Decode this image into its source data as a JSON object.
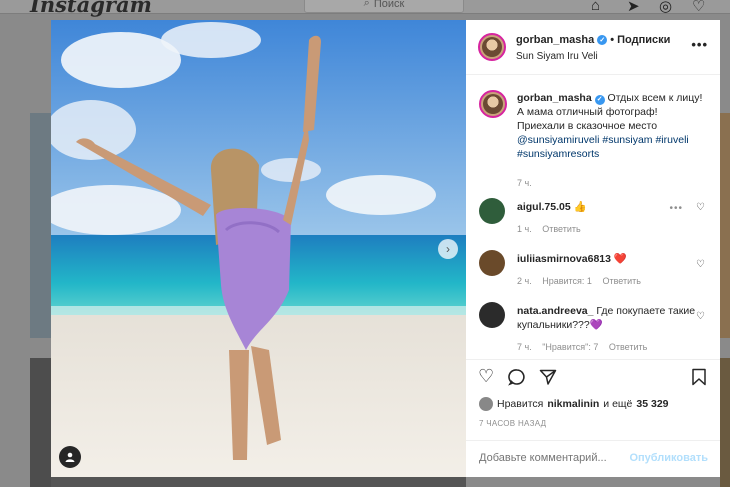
{
  "background": {
    "logo": "Instagram",
    "search_placeholder": "Поиск"
  },
  "post": {
    "username": "gorban_masha",
    "follow_separator": "•",
    "follow_label": "Подписки",
    "location": "Sun Siyam Iru Veli",
    "more_icon": "more-horizontal-icon"
  },
  "caption": {
    "username": "gorban_masha",
    "text_1": "Отдых всем к лицу! А мама отличный фотограф! Приехали в сказочное место",
    "mention": "@sunsiyamiruveli",
    "hashtags_1": "#sunsiyam #iruveli",
    "hashtags_2": "#sunsiyamresorts",
    "time": "7 ч."
  },
  "comments": [
    {
      "username": "aigul.75.05",
      "text": "👍",
      "time": "1 ч.",
      "likes": "",
      "reply": "Ответить"
    },
    {
      "username": "iuliiasmirnova6813",
      "text": "❤️",
      "time": "2 ч.",
      "likes": "Нравится: 1",
      "reply": "Ответить"
    },
    {
      "username": "nata.andreeva_",
      "text": "Где покупаете такие купальники???💜",
      "time": "7 ч.",
      "likes": "\"Нравится\": 7",
      "reply": "Ответить"
    }
  ],
  "actions": {
    "liked_by_prefix": "Нравится",
    "liked_by_user": "nikmalinin",
    "liked_by_and": "и ещё",
    "liked_by_count": "35 329",
    "posted_time": "7 ЧАСОВ НАЗАД",
    "comment_placeholder": "Добавьте комментарий...",
    "post_button": "Опубликовать"
  }
}
